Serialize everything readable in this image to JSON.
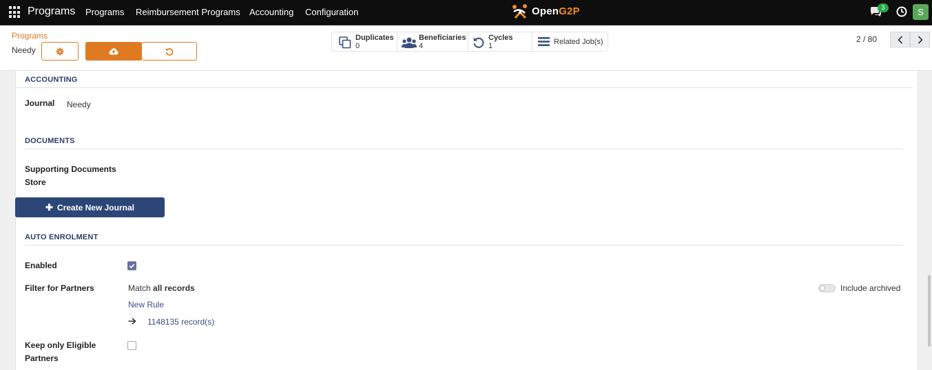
{
  "navbar": {
    "app_name": "Programs",
    "menu": [
      "Programs",
      "Reimbursement Programs",
      "Accounting",
      "Configuration"
    ],
    "logo_text_a": "Open",
    "logo_text_b": "G2P",
    "chat_count": "3",
    "avatar_letter": "S"
  },
  "control": {
    "breadcrumb_parent": "Programs",
    "breadcrumb_current": "Needy",
    "stats": [
      {
        "label": "Duplicates",
        "value": "0"
      },
      {
        "label": "Beneficiaries",
        "value": "4"
      },
      {
        "label": "Cycles",
        "value": "1"
      },
      {
        "label": "Related Job(s)"
      }
    ],
    "pager": "2 / 80"
  },
  "accounting": {
    "title": "ACCOUNTING",
    "journal_label": "Journal",
    "journal_value": "Needy"
  },
  "documents": {
    "title": "DOCUMENTS",
    "store_label_1": "Supporting Documents",
    "store_label_2": "Store"
  },
  "create_journal_label": "Create New Journal",
  "auto_enrolment": {
    "title": "AUTO ENROLMENT",
    "enabled_label": "Enabled",
    "enabled": true,
    "filter_label": "Filter for Partners",
    "match_prefix": "Match",
    "match_bold": "all records",
    "new_rule": "New Rule",
    "record_count": "1148135 record(s)",
    "include_archived": "Include archived",
    "keep_label_1": "Keep only Eligible",
    "keep_label_2": "Partners",
    "keep_eligible": false
  },
  "colors": {
    "accent": "#e07a22",
    "primary": "#2b4677",
    "section": "#2b3e67"
  }
}
